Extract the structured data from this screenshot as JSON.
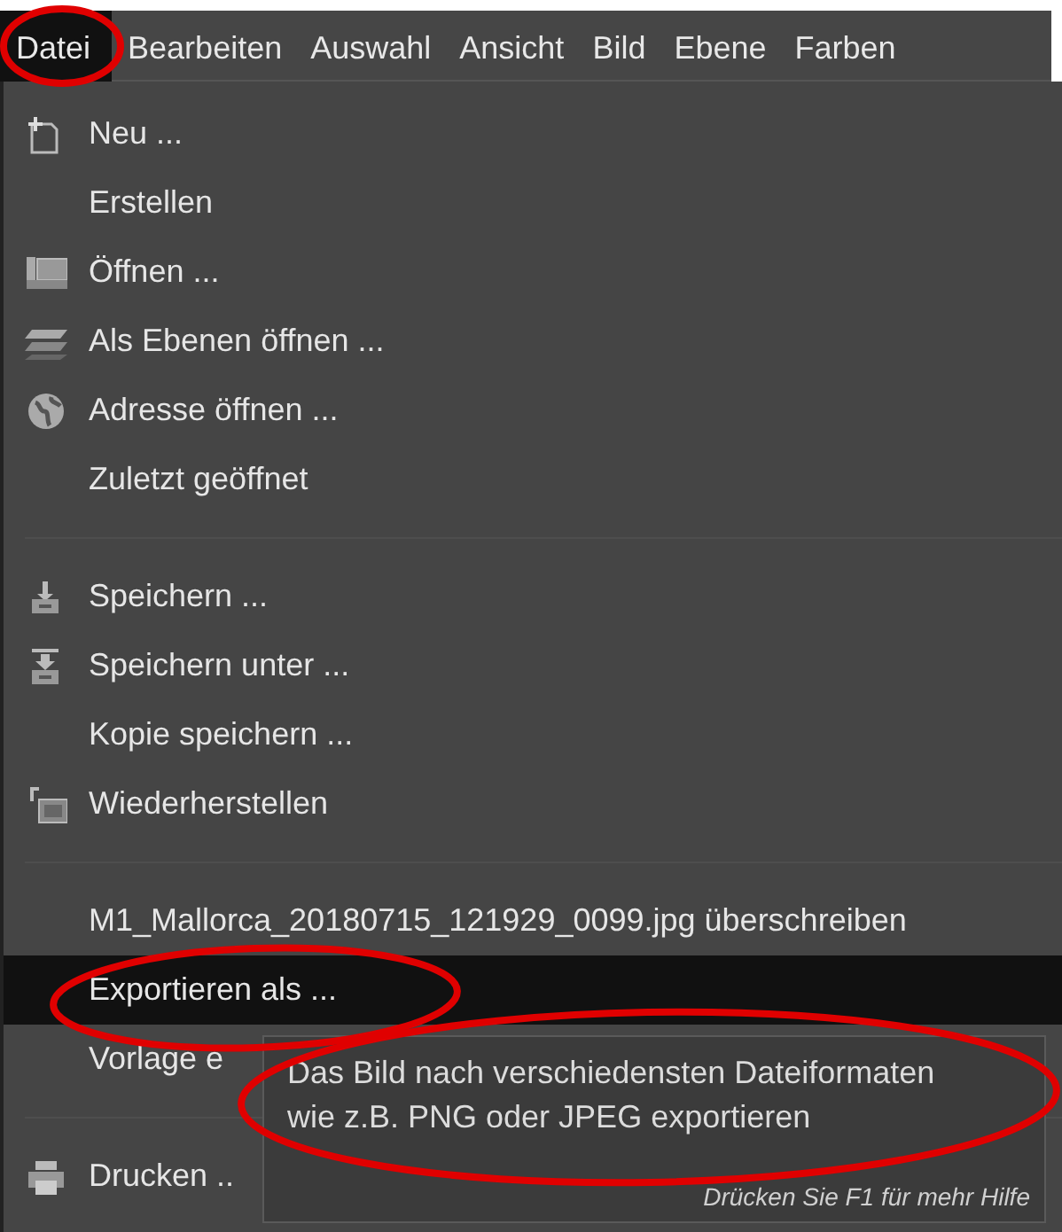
{
  "menubar": [
    {
      "label": "Datei",
      "selected": true
    },
    {
      "label": "Bearbeiten",
      "selected": false
    },
    {
      "label": "Auswahl",
      "selected": false
    },
    {
      "label": "Ansicht",
      "selected": false
    },
    {
      "label": "Bild",
      "selected": false
    },
    {
      "label": "Ebene",
      "selected": false
    },
    {
      "label": "Farben",
      "selected": false
    }
  ],
  "menu": {
    "sections": [
      [
        {
          "label": "Neu ...",
          "icon": true,
          "selected": false
        },
        {
          "label": "Erstellen",
          "icon": false,
          "selected": false
        },
        {
          "label": "Öffnen ...",
          "icon": true,
          "selected": false
        },
        {
          "label": "Als Ebenen öffnen ...",
          "icon": true,
          "selected": false
        },
        {
          "label": "Adresse öffnen ...",
          "icon": true,
          "selected": false
        },
        {
          "label": "Zuletzt geöffnet",
          "icon": false,
          "selected": false
        }
      ],
      [
        {
          "label": "Speichern ...",
          "icon": true,
          "selected": false
        },
        {
          "label": "Speichern unter ...",
          "icon": true,
          "selected": false
        },
        {
          "label": "Kopie speichern ...",
          "icon": false,
          "selected": false
        },
        {
          "label": "Wiederherstellen",
          "icon": true,
          "selected": false
        }
      ],
      [
        {
          "label": "M1_Mallorca_20180715_121929_0099.jpg überschreiben",
          "icon": false,
          "selected": false
        },
        {
          "label": "Exportieren als ...",
          "icon": false,
          "selected": true
        },
        {
          "label": "Vorlage e",
          "icon": false,
          "selected": false
        }
      ],
      [
        {
          "label": "Drucken ..",
          "icon": true,
          "selected": false
        }
      ]
    ]
  },
  "tooltip": {
    "text": "Das Bild nach verschiedensten Dateiformaten\nwie z.B. PNG oder JPEG exportieren",
    "help": "Drücken Sie F1 für mehr Hilfe"
  },
  "annotations": [
    {
      "kind": "ellipse"
    },
    {
      "kind": "ellipse"
    },
    {
      "kind": "ellipse"
    }
  ]
}
